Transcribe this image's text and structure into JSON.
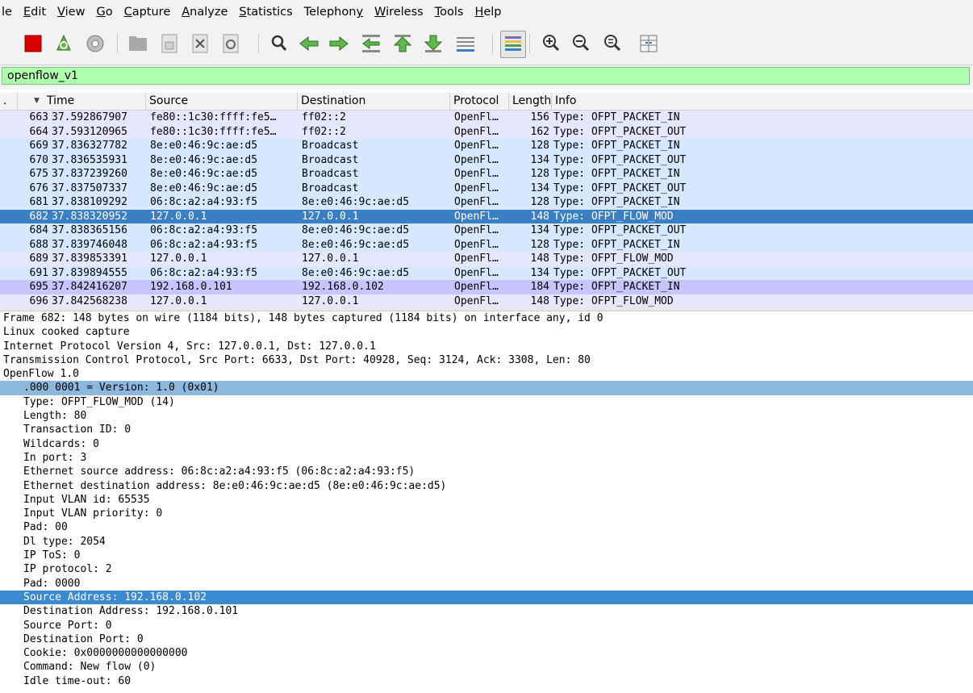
{
  "menu": [
    "le",
    "Edit",
    "View",
    "Go",
    "Capture",
    "Analyze",
    "Statistics",
    "Telephony",
    "Wireless",
    "Tools",
    "Help"
  ],
  "menu_underline": [
    -1,
    0,
    0,
    0,
    0,
    0,
    0,
    8,
    0,
    0,
    0
  ],
  "toolbar_icons": [
    "shark-fin-partial-icon",
    "stop-capture-icon",
    "restart-capture-icon",
    "capture-options-icon",
    "open-file-icon",
    "save-file-icon",
    "close-file-icon",
    "reload-file-icon",
    "find-packet-icon",
    "go-back-icon",
    "go-forward-icon",
    "go-to-packet-icon",
    "go-first-packet-icon",
    "go-last-packet-icon",
    "auto-scroll-icon",
    "colorize-icon",
    "zoom-in-icon",
    "zoom-out-icon",
    "normal-size-icon",
    "resize-columns-icon"
  ],
  "filter": {
    "value": "openflow_v1"
  },
  "columns": {
    "no": ".",
    "time": "Time",
    "source": "Source",
    "destination": "Destination",
    "protocol": "Protocol",
    "length": "Length",
    "info": "Info"
  },
  "colors": {
    "row_default": "#e7e6ff",
    "row_arp": "#d6e8ff",
    "row_selected": "#3a7fc3",
    "row_violet": "#c7c4ff",
    "detail_highlight": "#8cb8dd",
    "detail_selected": "#3a8ad2",
    "filter_green": "#afffaf"
  },
  "packets": [
    {
      "no": "663",
      "time": "37.592867907",
      "src": "fe80::1c30:ffff:fe5…",
      "dst": "ff02::2",
      "proto": "OpenFl…",
      "len": "156",
      "info": "Type: OFPT_PACKET_IN",
      "style": "default"
    },
    {
      "no": "664",
      "time": "37.593120965",
      "src": "fe80::1c30:ffff:fe5…",
      "dst": "ff02::2",
      "proto": "OpenFl…",
      "len": "162",
      "info": "Type: OFPT_PACKET_OUT",
      "style": "default"
    },
    {
      "no": "669",
      "time": "37.836327782",
      "src": "8e:e0:46:9c:ae:d5",
      "dst": "Broadcast",
      "proto": "OpenFl…",
      "len": "128",
      "info": "Type: OFPT_PACKET_IN",
      "style": "arp"
    },
    {
      "no": "670",
      "time": "37.836535931",
      "src": "8e:e0:46:9c:ae:d5",
      "dst": "Broadcast",
      "proto": "OpenFl…",
      "len": "134",
      "info": "Type: OFPT_PACKET_OUT",
      "style": "arp"
    },
    {
      "no": "675",
      "time": "37.837239260",
      "src": "8e:e0:46:9c:ae:d5",
      "dst": "Broadcast",
      "proto": "OpenFl…",
      "len": "128",
      "info": "Type: OFPT_PACKET_IN",
      "style": "arp"
    },
    {
      "no": "676",
      "time": "37.837507337",
      "src": "8e:e0:46:9c:ae:d5",
      "dst": "Broadcast",
      "proto": "OpenFl…",
      "len": "134",
      "info": "Type: OFPT_PACKET_OUT",
      "style": "arp"
    },
    {
      "no": "681",
      "time": "37.838109292",
      "src": "06:8c:a2:a4:93:f5",
      "dst": "8e:e0:46:9c:ae:d5",
      "proto": "OpenFl…",
      "len": "128",
      "info": "Type: OFPT_PACKET_IN",
      "style": "arp"
    },
    {
      "no": "682",
      "time": "37.838320952",
      "src": "127.0.0.1",
      "dst": "127.0.0.1",
      "proto": "OpenFl…",
      "len": "148",
      "info": "Type: OFPT_FLOW_MOD",
      "style": "selected"
    },
    {
      "no": "684",
      "time": "37.838365156",
      "src": "06:8c:a2:a4:93:f5",
      "dst": "8e:e0:46:9c:ae:d5",
      "proto": "OpenFl…",
      "len": "134",
      "info": "Type: OFPT_PACKET_OUT",
      "style": "arp"
    },
    {
      "no": "688",
      "time": "37.839746048",
      "src": "06:8c:a2:a4:93:f5",
      "dst": "8e:e0:46:9c:ae:d5",
      "proto": "OpenFl…",
      "len": "128",
      "info": "Type: OFPT_PACKET_IN",
      "style": "arp"
    },
    {
      "no": "689",
      "time": "37.839853391",
      "src": "127.0.0.1",
      "dst": "127.0.0.1",
      "proto": "OpenFl…",
      "len": "148",
      "info": "Type: OFPT_FLOW_MOD",
      "style": "default"
    },
    {
      "no": "691",
      "time": "37.839894555",
      "src": "06:8c:a2:a4:93:f5",
      "dst": "8e:e0:46:9c:ae:d5",
      "proto": "OpenFl…",
      "len": "134",
      "info": "Type: OFPT_PACKET_OUT",
      "style": "arp"
    },
    {
      "no": "695",
      "time": "37.842416207",
      "src": "192.168.0.101",
      "dst": "192.168.0.102",
      "proto": "OpenFl…",
      "len": "184",
      "info": "Type: OFPT_PACKET_IN",
      "style": "violet"
    },
    {
      "no": "696",
      "time": "37.842568238",
      "src": "127.0.0.1",
      "dst": "127.0.0.1",
      "proto": "OpenFl…",
      "len": "148",
      "info": "Type: OFPT_FLOW_MOD",
      "style": "default"
    }
  ],
  "details": [
    {
      "text": "Frame 682: 148 bytes on wire (1184 bits), 148 bytes captured (1184 bits) on interface any, id 0",
      "indent": 0,
      "style": ""
    },
    {
      "text": "Linux cooked capture",
      "indent": 0,
      "style": ""
    },
    {
      "text": "Internet Protocol Version 4, Src: 127.0.0.1, Dst: 127.0.0.1",
      "indent": 0,
      "style": ""
    },
    {
      "text": "Transmission Control Protocol, Src Port: 6633, Dst Port: 40928, Seq: 3124, Ack: 3308, Len: 80",
      "indent": 0,
      "style": ""
    },
    {
      "text": "OpenFlow 1.0",
      "indent": 0,
      "style": ""
    },
    {
      "text": ".000 0001 = Version: 1.0 (0x01)",
      "indent": 1,
      "style": "highlight"
    },
    {
      "text": "Type: OFPT_FLOW_MOD (14)",
      "indent": 1,
      "style": ""
    },
    {
      "text": "Length: 80",
      "indent": 1,
      "style": ""
    },
    {
      "text": "Transaction ID: 0",
      "indent": 1,
      "style": ""
    },
    {
      "text": "Wildcards: 0",
      "indent": 1,
      "style": ""
    },
    {
      "text": "In port: 3",
      "indent": 1,
      "style": ""
    },
    {
      "text": "Ethernet source address: 06:8c:a2:a4:93:f5 (06:8c:a2:a4:93:f5)",
      "indent": 1,
      "style": ""
    },
    {
      "text": "Ethernet destination address: 8e:e0:46:9c:ae:d5 (8e:e0:46:9c:ae:d5)",
      "indent": 1,
      "style": ""
    },
    {
      "text": "Input VLAN id: 65535",
      "indent": 1,
      "style": ""
    },
    {
      "text": "Input VLAN priority: 0",
      "indent": 1,
      "style": ""
    },
    {
      "text": "Pad: 00",
      "indent": 1,
      "style": ""
    },
    {
      "text": "Dl type: 2054",
      "indent": 1,
      "style": ""
    },
    {
      "text": "IP ToS: 0",
      "indent": 1,
      "style": ""
    },
    {
      "text": "IP protocol: 2",
      "indent": 1,
      "style": ""
    },
    {
      "text": "Pad: 0000",
      "indent": 1,
      "style": ""
    },
    {
      "text": "Source Address: 192.168.0.102",
      "indent": 1,
      "style": "selected"
    },
    {
      "text": "Destination Address: 192.168.0.101",
      "indent": 1,
      "style": ""
    },
    {
      "text": "Source Port: 0",
      "indent": 1,
      "style": ""
    },
    {
      "text": "Destination Port: 0",
      "indent": 1,
      "style": ""
    },
    {
      "text": "Cookie: 0x0000000000000000",
      "indent": 1,
      "style": ""
    },
    {
      "text": "Command: New flow (0)",
      "indent": 1,
      "style": ""
    },
    {
      "text": "Idle time-out: 60",
      "indent": 1,
      "style": ""
    }
  ]
}
